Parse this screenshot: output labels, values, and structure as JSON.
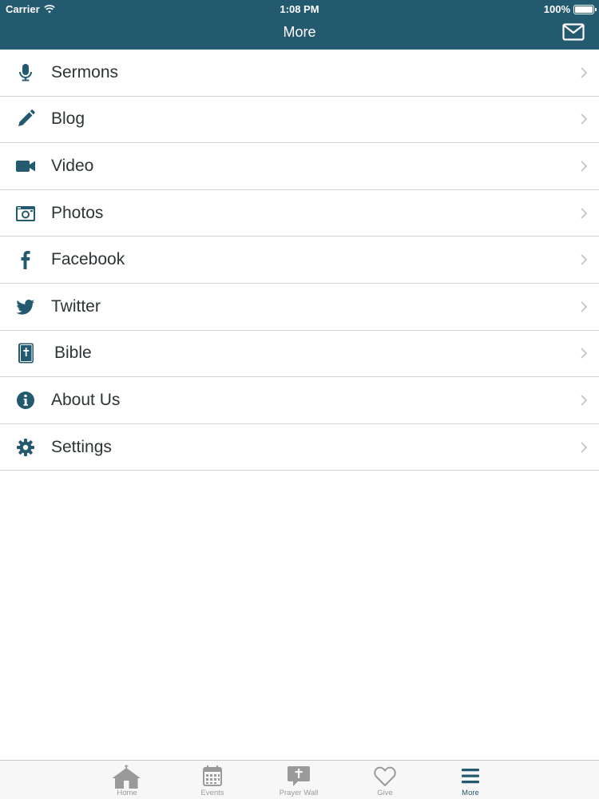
{
  "status_bar": {
    "carrier": "Carrier",
    "time": "1:08 PM",
    "battery": "100%"
  },
  "nav": {
    "title": "More",
    "mail_icon": "envelope-icon"
  },
  "colors": {
    "brand": "#245a70",
    "icon": "#245a70",
    "divider": "#d4d4d4",
    "chevron": "#c4c4c4",
    "tab_inactive": "#9a9a9a"
  },
  "menu": {
    "items": [
      {
        "label": "Sermons",
        "icon": "microphone-icon"
      },
      {
        "label": "Blog",
        "icon": "pencil-icon"
      },
      {
        "label": "Video",
        "icon": "video-camera-icon"
      },
      {
        "label": "Photos",
        "icon": "camera-icon"
      },
      {
        "label": "Facebook",
        "icon": "facebook-icon"
      },
      {
        "label": "Twitter",
        "icon": "twitter-icon"
      },
      {
        "label": "Bible",
        "icon": "bible-icon"
      },
      {
        "label": "About Us",
        "icon": "info-icon"
      },
      {
        "label": "Settings",
        "icon": "gear-icon"
      }
    ]
  },
  "tabbar": {
    "tabs": [
      {
        "label": "Home",
        "icon": "church-icon"
      },
      {
        "label": "Events",
        "icon": "calendar-icon"
      },
      {
        "label": "Prayer Wall",
        "icon": "prayer-bubble-icon"
      },
      {
        "label": "Give",
        "icon": "heart-icon"
      },
      {
        "label": "More",
        "icon": "hamburger-menu-icon"
      }
    ],
    "active": "More"
  }
}
